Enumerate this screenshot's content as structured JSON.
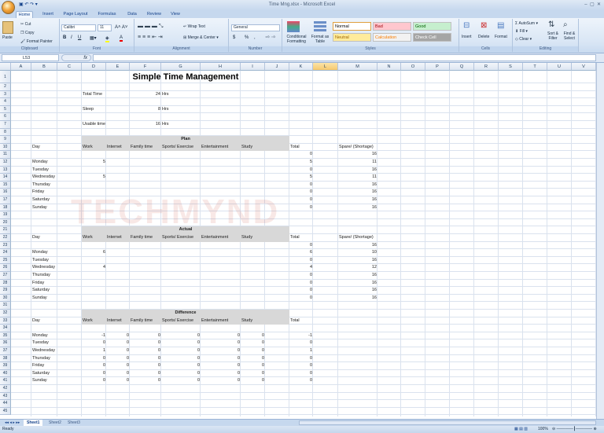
{
  "window": {
    "title": "Time Mng.xlsx - Microsoft Excel"
  },
  "ribbon_tabs": [
    "Home",
    "Insert",
    "Page Layout",
    "Formulas",
    "Data",
    "Review",
    "View"
  ],
  "active_tab": "Home",
  "ribbon": {
    "clipboard": {
      "label": "Clipboard",
      "paste": "Paste",
      "cut": "Cut",
      "copy": "Copy",
      "format_painter": "Format Painter"
    },
    "font": {
      "label": "Font",
      "name": "Calibri",
      "size": "11",
      "bold": "B",
      "italic": "I",
      "underline": "U"
    },
    "alignment": {
      "label": "Alignment",
      "wrap": "Wrap Text",
      "merge": "Merge & Center"
    },
    "number": {
      "label": "Number",
      "format": "General",
      "currency": "$",
      "percent": "%",
      "comma": ","
    },
    "styles": {
      "label": "Styles",
      "conditional": "Conditional Formatting",
      "format_table": "Format as Table",
      "items": [
        {
          "label": "Normal",
          "bg": "#ffffff",
          "fg": "#000000"
        },
        {
          "label": "Bad",
          "bg": "#ffc7ce",
          "fg": "#9c0006"
        },
        {
          "label": "Good",
          "bg": "#c6efce",
          "fg": "#006100"
        },
        {
          "label": "Neutral",
          "bg": "#ffeb9c",
          "fg": "#9c6500"
        },
        {
          "label": "Calculation",
          "bg": "#f2f2f2",
          "fg": "#fa7d00"
        },
        {
          "label": "Check Cell",
          "bg": "#a5a5a5",
          "fg": "#ffffff"
        }
      ]
    },
    "cells": {
      "label": "Cells",
      "insert": "Insert",
      "delete": "Delete",
      "format": "Format"
    },
    "editing": {
      "label": "Editing",
      "autosum": "AutoSum",
      "fill": "Fill",
      "clear": "Clear",
      "sort": "Sort & Filter",
      "find": "Find & Select"
    }
  },
  "formula_bar": {
    "name_box": "L53",
    "fx": "fx",
    "value": ""
  },
  "columns": [
    "A",
    "B",
    "C",
    "D",
    "E",
    "F",
    "G",
    "H",
    "I",
    "J",
    "K",
    "L",
    "M",
    "N",
    "O",
    "P",
    "Q",
    "R",
    "S",
    "T",
    "U",
    "V"
  ],
  "selected_column": "L",
  "row_count": 45,
  "title": "Simple Time Management",
  "cells": [
    {
      "row": 3,
      "col": "D",
      "v": "Total Time"
    },
    {
      "row": 3,
      "col": "F",
      "v": "24",
      "n": true
    },
    {
      "row": 3,
      "col": "G",
      "v": "Hrs"
    },
    {
      "row": 5,
      "col": "D",
      "v": "Sleep"
    },
    {
      "row": 5,
      "col": "F",
      "v": "8",
      "n": true
    },
    {
      "row": 5,
      "col": "G",
      "v": "Hrs"
    },
    {
      "row": 7,
      "col": "D",
      "v": "Usable time"
    },
    {
      "row": 7,
      "col": "F",
      "v": "16",
      "n": true
    },
    {
      "row": 7,
      "col": "G",
      "v": "Hrs"
    }
  ],
  "sections": [
    {
      "name": "Plan",
      "title_row": 9,
      "header_row": 10,
      "first_row": 11,
      "spare_header": "Spare/ (Shortage)",
      "rows": [
        {
          "day": "",
          "values": [
            "",
            "",
            "",
            "",
            "",
            ""
          ],
          "total": "0",
          "spare": "16"
        },
        {
          "day": "Monday",
          "values": [
            "5",
            "",
            "",
            "",
            "",
            ""
          ],
          "total": "5",
          "spare": "11"
        },
        {
          "day": "Tuesday",
          "values": [
            "",
            "",
            "",
            "",
            "",
            ""
          ],
          "total": "0",
          "spare": "16"
        },
        {
          "day": "Wednesday",
          "values": [
            "5",
            "",
            "",
            "",
            "",
            ""
          ],
          "total": "5",
          "spare": "11"
        },
        {
          "day": "Thursday",
          "values": [
            "",
            "",
            "",
            "",
            "",
            ""
          ],
          "total": "0",
          "spare": "16"
        },
        {
          "day": "Friday",
          "values": [
            "",
            "",
            "",
            "",
            "",
            ""
          ],
          "total": "0",
          "spare": "16"
        },
        {
          "day": "Saturday",
          "values": [
            "",
            "",
            "",
            "",
            "",
            ""
          ],
          "total": "0",
          "spare": "16"
        },
        {
          "day": "Sunday",
          "values": [
            "",
            "",
            "",
            "",
            "",
            ""
          ],
          "total": "0",
          "spare": "16"
        }
      ]
    },
    {
      "name": "Actual",
      "title_row": 21,
      "header_row": 22,
      "first_row": 23,
      "spare_header": "Spare/ (Shortage)",
      "rows": [
        {
          "day": "",
          "values": [
            "",
            "",
            "",
            "",
            "",
            ""
          ],
          "total": "0",
          "spare": "16"
        },
        {
          "day": "Monday",
          "values": [
            "6",
            "",
            "",
            "",
            "",
            ""
          ],
          "total": "6",
          "spare": "10"
        },
        {
          "day": "Tuesday",
          "values": [
            "",
            "",
            "",
            "",
            "",
            ""
          ],
          "total": "0",
          "spare": "16"
        },
        {
          "day": "Wednesday",
          "values": [
            "4",
            "",
            "",
            "",
            "",
            ""
          ],
          "total": "4",
          "spare": "12"
        },
        {
          "day": "Thursday",
          "values": [
            "",
            "",
            "",
            "",
            "",
            ""
          ],
          "total": "0",
          "spare": "16"
        },
        {
          "day": "Friday",
          "values": [
            "",
            "",
            "",
            "",
            "",
            ""
          ],
          "total": "0",
          "spare": "16"
        },
        {
          "day": "Saturday",
          "values": [
            "",
            "",
            "",
            "",
            "",
            ""
          ],
          "total": "0",
          "spare": "16"
        },
        {
          "day": "Sunday",
          "values": [
            "",
            "",
            "",
            "",
            "",
            ""
          ],
          "total": "0",
          "spare": "16"
        }
      ]
    },
    {
      "name": "Difference",
      "title_row": 32,
      "header_row": 33,
      "first_row": 35,
      "spare_header": "",
      "rows": [
        {
          "day": "Monday",
          "values": [
            "-1",
            "0",
            "0",
            "0",
            "0",
            "0"
          ],
          "total": "-1",
          "spare": ""
        },
        {
          "day": "Tuesday",
          "values": [
            "0",
            "0",
            "0",
            "0",
            "0",
            "0"
          ],
          "total": "0",
          "spare": ""
        },
        {
          "day": "Wednesday",
          "values": [
            "1",
            "0",
            "0",
            "0",
            "0",
            "0"
          ],
          "total": "1",
          "spare": ""
        },
        {
          "day": "Thursday",
          "values": [
            "0",
            "0",
            "0",
            "0",
            "0",
            "0"
          ],
          "total": "0",
          "spare": ""
        },
        {
          "day": "Friday",
          "values": [
            "0",
            "0",
            "0",
            "0",
            "0",
            "0"
          ],
          "total": "0",
          "spare": ""
        },
        {
          "day": "Saturday",
          "values": [
            "0",
            "0",
            "0",
            "0",
            "0",
            "0"
          ],
          "total": "0",
          "spare": ""
        },
        {
          "day": "Sunday",
          "values": [
            "0",
            "0",
            "0",
            "0",
            "0",
            "0"
          ],
          "total": "0",
          "spare": ""
        }
      ]
    }
  ],
  "table_headers": {
    "day": "Day",
    "activities": [
      "Work",
      "Internet",
      "Family time",
      "Sports/ Exercise",
      "Entertainment",
      "Study"
    ],
    "total": "Total"
  },
  "watermark": "TECHMYND",
  "sheets": [
    "Sheet1",
    "Sheet2",
    "Sheet3"
  ],
  "active_sheet": "Sheet1",
  "status": {
    "text": "Ready",
    "zoom": "100%"
  }
}
